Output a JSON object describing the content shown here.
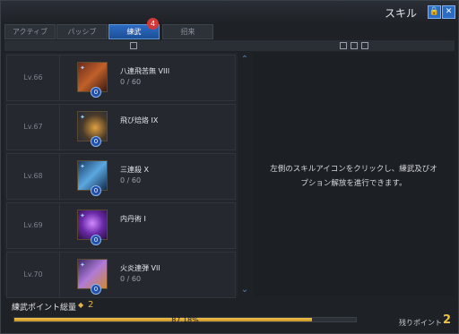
{
  "window": {
    "title": "スキル",
    "lock_icon": "lock-icon",
    "close_icon": "close-icon"
  },
  "tabs": [
    {
      "label": "アクティブ",
      "active": false
    },
    {
      "label": "パッシブ",
      "active": false
    },
    {
      "label": "練武",
      "active": true,
      "badge": "4"
    },
    {
      "label": "招来",
      "active": false
    }
  ],
  "subheader": {
    "icons": [
      "grid-icon",
      "list-icon",
      "filter-icon"
    ]
  },
  "skills": [
    {
      "level": "Lv.66",
      "name": "八連飛苦無 VIII",
      "progress": "0 / 60",
      "badge": "0",
      "icon": "kunai-skill-icon"
    },
    {
      "level": "Lv.67",
      "name": "飛び焙烙 IX",
      "progress": "",
      "badge": "0",
      "icon": "bomb-skill-icon"
    },
    {
      "level": "Lv.68",
      "name": "三連殺 X",
      "progress": "0 / 60",
      "badge": "0",
      "icon": "triple-slash-skill-icon"
    },
    {
      "level": "Lv.69",
      "name": "内丹術 I",
      "progress": "",
      "badge": "0",
      "icon": "inner-alchemy-skill-icon"
    },
    {
      "level": "Lv.70",
      "name": "火炎連弾 VII",
      "progress": "0 / 60",
      "badge": "0",
      "icon": "flame-barrage-skill-icon"
    }
  ],
  "detail": {
    "message": "左側のスキルアイコンをクリックし、練武及びオ\nプション解放を進行できます。"
  },
  "footer": {
    "total_label": "練武ポイント総量",
    "total_value": "2",
    "progress_text": "87.18%",
    "progress_fraction": 0.8718,
    "remain_label": "残りポイント",
    "remain_value": "2"
  },
  "colors": {
    "accent": "#2b6cc4",
    "gold": "#e0b64a",
    "badge_red": "#d23a3a"
  }
}
